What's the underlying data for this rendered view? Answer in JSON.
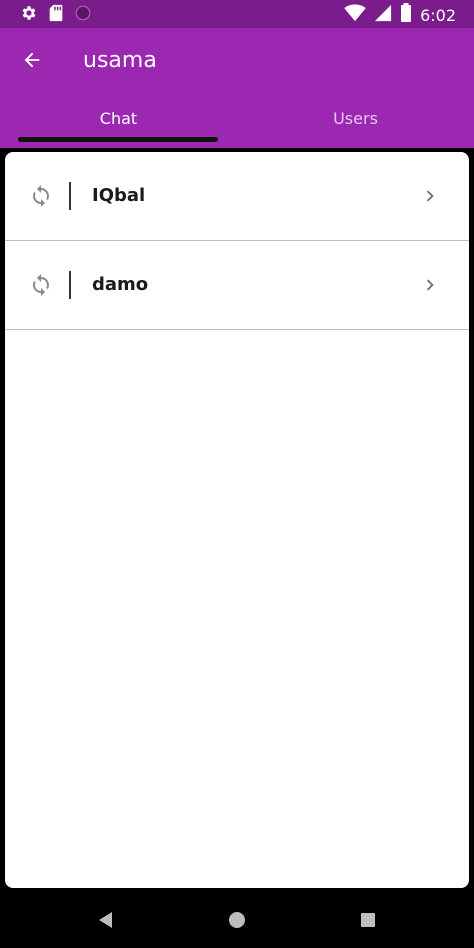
{
  "status_bar": {
    "time": "6:02",
    "icons": [
      "settings-icon",
      "sd-card-icon",
      "circle-icon",
      "wifi-icon",
      "signal-icon",
      "battery-icon"
    ]
  },
  "app_bar": {
    "title": "usama",
    "back_icon": "arrow-back-icon",
    "color": "#9c27b0",
    "status_color": "#7b1c8c"
  },
  "tabs": [
    {
      "label": "Chat",
      "active": true
    },
    {
      "label": "Users",
      "active": false
    }
  ],
  "list": {
    "items": [
      {
        "name": "IQbal",
        "icon": "refresh-icon",
        "trailing_icon": "chevron-right-icon"
      },
      {
        "name": "damo",
        "icon": "refresh-icon",
        "trailing_icon": "chevron-right-icon"
      }
    ]
  },
  "nav_bar": {
    "buttons": [
      "back-triangle-icon",
      "home-circle-icon",
      "recents-square-icon"
    ]
  }
}
